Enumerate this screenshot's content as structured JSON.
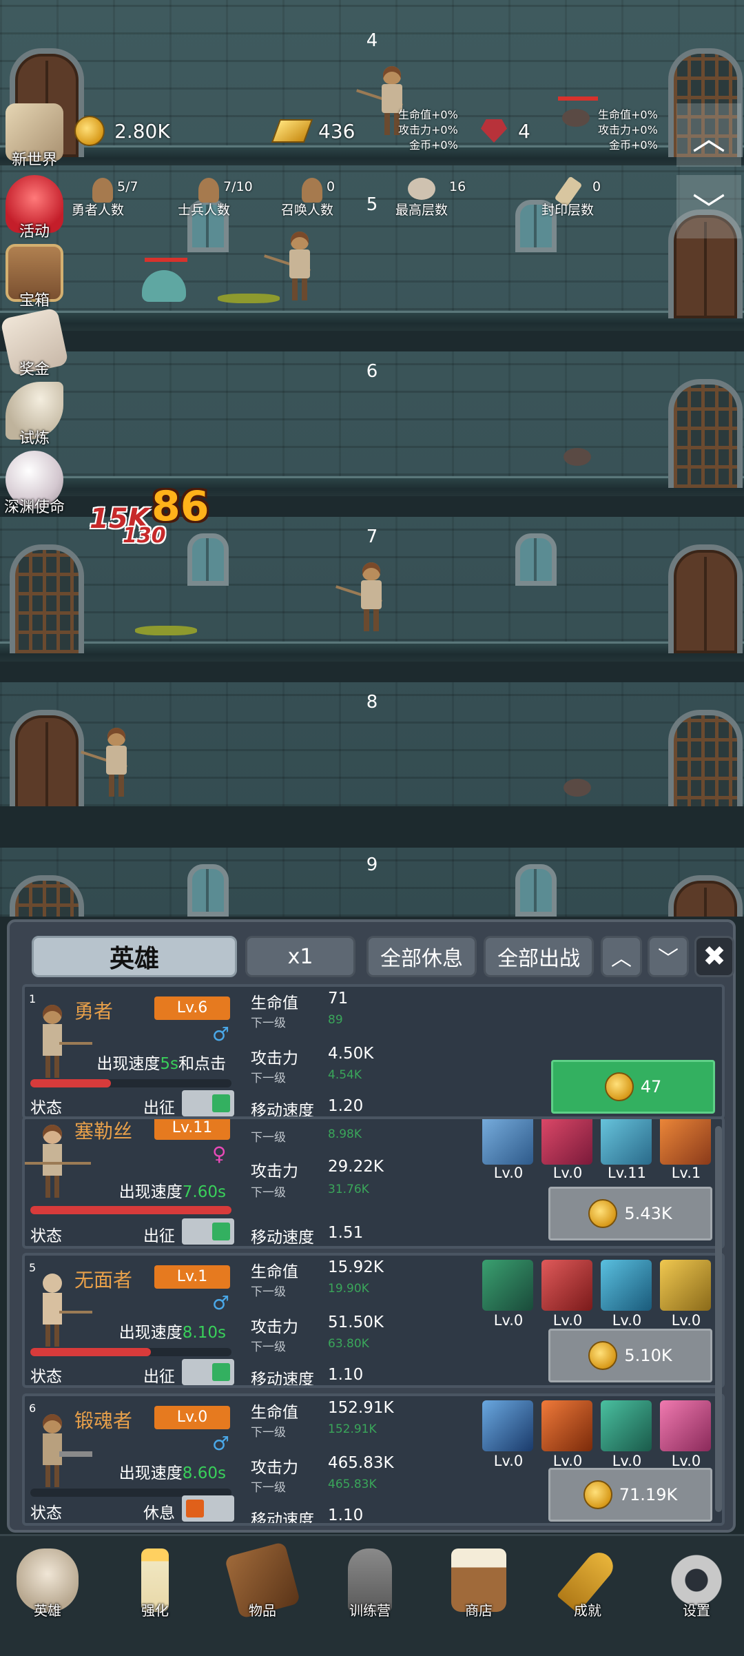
{
  "colors": {
    "accent_orange": "#e67a1f",
    "speed_green": "#39d05a",
    "buy_green": "#33b060",
    "hp_red": "#d83b3b",
    "male_blue": "#4aa8e8",
    "female_pink": "#e84ab8"
  },
  "floors": [
    "4",
    "5",
    "6",
    "7",
    "8",
    "9"
  ],
  "side_menu": [
    {
      "label": "新世界",
      "icon": "map-icon"
    },
    {
      "label": "活动",
      "icon": "heart-icon"
    },
    {
      "label": "宝箱",
      "icon": "treasure-chest-icon"
    },
    {
      "label": "奖金",
      "icon": "envelope-icon"
    },
    {
      "label": "试炼",
      "icon": "feather-icon"
    },
    {
      "label": "深渊使命",
      "icon": "pearl-icon"
    }
  ],
  "resources": {
    "gold": "2.80K",
    "gold_bar": "436",
    "gem": "4"
  },
  "bonuses_left": [
    "生命值+0%",
    "攻击力+0%",
    "金币+0%"
  ],
  "bonuses_right": [
    "生命值+0%",
    "攻击力+0%",
    "金币+0%"
  ],
  "counts": [
    {
      "value": "5/7",
      "label": "勇者人数"
    },
    {
      "value": "7/10",
      "label": "士兵人数"
    },
    {
      "value": "0",
      "label": "召唤人数"
    },
    {
      "value": "16",
      "label": "最高层数"
    },
    {
      "value": "0",
      "label": "封印层数"
    }
  ],
  "damage": {
    "big": "86",
    "red": "15K",
    "red2": "130"
  },
  "panel": {
    "tab_label": "英雄",
    "multiplier": "x1",
    "rest_all": "全部休息",
    "deploy_all": "全部出战"
  },
  "heroes": [
    {
      "index": "1",
      "name": "勇者",
      "level": "Lv.6",
      "gender": "♂",
      "speed_prefix": "出现速度",
      "speed": "5s",
      "speed_suffix": "和点击",
      "hp_fill": 0.5,
      "hp_label": "生命值",
      "hp": "71",
      "next_label": "下一级",
      "hp_next": "89",
      "atk_label": "攻击力",
      "atk": "4.50K",
      "atk_next": "4.54K",
      "move_label": "移动速度",
      "move": "1.20",
      "state_label": "状态",
      "deploy_label": "出征",
      "toggle_on": true,
      "cost": "47"
    },
    {
      "index": "",
      "name": "塞勒丝",
      "level": "Lv.11",
      "gender": "♀",
      "speed_prefix": "出现速度",
      "speed": "7.60s",
      "hp_fill": 1.0,
      "hp_label": "生命值",
      "hp": "",
      "next_label": "下一级",
      "hp_next": "8.98K",
      "atk_label": "攻击力",
      "atk": "29.22K",
      "atk_next": "31.76K",
      "move_label": "移动速度",
      "move": "1.51",
      "state_label": "状态",
      "deploy_label": "出征",
      "toggle_on": true,
      "cost": "5.43K",
      "equipment": [
        {
          "icon": "star-shield-icon",
          "level": "Lv.0"
        },
        {
          "icon": "red-beast-icon",
          "level": "Lv.0"
        },
        {
          "icon": "armor-icon",
          "level": "Lv.11"
        },
        {
          "icon": "torch-icon",
          "level": "Lv.1"
        }
      ]
    },
    {
      "index": "5",
      "name": "无面者",
      "level": "Lv.1",
      "gender": "♂",
      "speed_prefix": "出现速度",
      "speed": "8.10s",
      "hp_fill": 0.6,
      "hp_label": "生命值",
      "hp": "15.92K",
      "next_label": "下一级",
      "hp_next": "19.90K",
      "atk_label": "攻击力",
      "atk": "51.50K",
      "atk_next": "63.80K",
      "move_label": "移动速度",
      "move": "1.10",
      "state_label": "状态",
      "deploy_label": "出征",
      "toggle_on": true,
      "cost": "5.10K",
      "equipment": [
        {
          "icon": "sword-shield-icon",
          "level": "Lv.0"
        },
        {
          "icon": "sword-icon",
          "level": "Lv.0"
        },
        {
          "icon": "boot-icon",
          "level": "Lv.0"
        },
        {
          "icon": "helmet-icon",
          "level": "Lv.0"
        }
      ]
    },
    {
      "index": "6",
      "name": "锻魂者",
      "level": "Lv.0",
      "gender": "♂",
      "speed_prefix": "出现速度",
      "speed": "8.60s",
      "hp_fill": 0.0,
      "hp_label": "生命值",
      "hp": "152.91K",
      "next_label": "下一级",
      "hp_next": "152.91K",
      "atk_label": "攻击力",
      "atk": "465.83K",
      "atk_next": "465.83K",
      "move_label": "移动速度",
      "move": "1.10",
      "state_label": "状态",
      "deploy_label": "休息",
      "toggle_on": false,
      "cost": "71.19K",
      "equipment": [
        {
          "icon": "skull-shield-icon",
          "level": "Lv.0"
        },
        {
          "icon": "axe-icon",
          "level": "Lv.0"
        },
        {
          "icon": "hammer-icon",
          "level": "Lv.0"
        },
        {
          "icon": "pink-boot-icon",
          "level": "Lv.0"
        }
      ]
    }
  ],
  "nav": [
    {
      "label": "英雄",
      "icon": "skull-icon"
    },
    {
      "label": "强化",
      "icon": "candle-icon"
    },
    {
      "label": "物品",
      "icon": "book-icon"
    },
    {
      "label": "训练营",
      "icon": "lantern-icon"
    },
    {
      "label": "商店",
      "icon": "mug-icon"
    },
    {
      "label": "成就",
      "icon": "key-icon"
    },
    {
      "label": "设置",
      "icon": "gear-icon"
    }
  ]
}
